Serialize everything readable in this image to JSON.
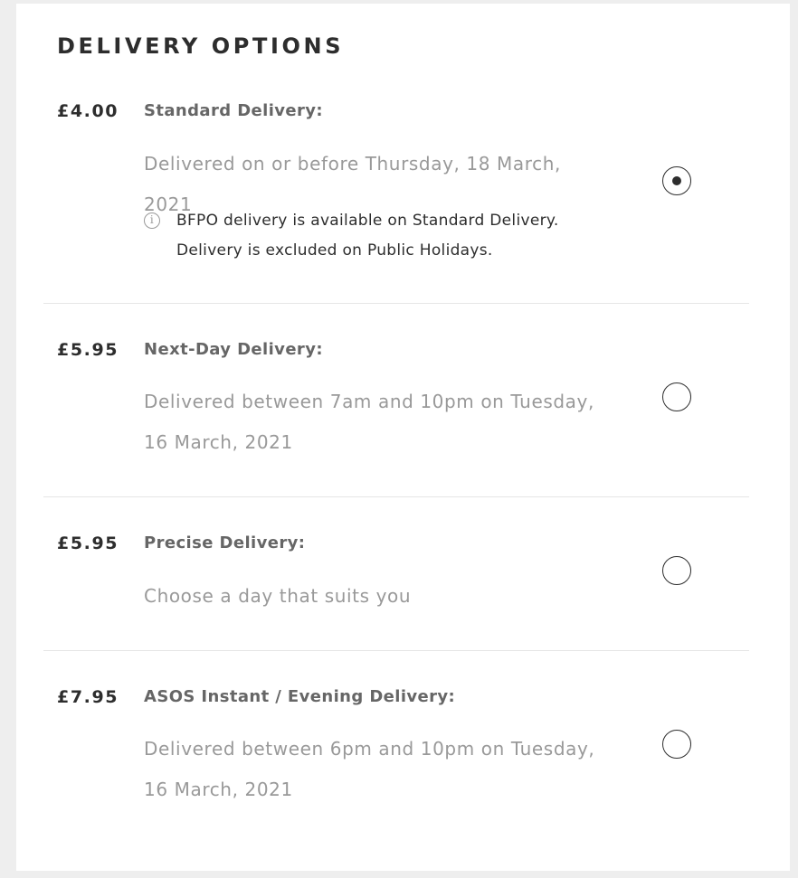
{
  "header": {
    "title": "DELIVERY OPTIONS"
  },
  "options": [
    {
      "price": "£4.00",
      "name": "Standard Delivery:",
      "description": "Delivered on or before Thursday, 18 March, 2021",
      "info_line1": "BFPO delivery is available on Standard Delivery.",
      "info_line2": "Delivery is excluded on Public Holidays.",
      "selected": true
    },
    {
      "price": "£5.95",
      "name": "Next-Day Delivery:",
      "description": "Delivered between 7am and 10pm on Tuesday, 16 March, 2021",
      "selected": false
    },
    {
      "price": "£5.95",
      "name": "Precise Delivery:",
      "description": "Choose a day that suits you",
      "selected": false
    },
    {
      "price": "£7.95",
      "name": "ASOS Instant / Evening Delivery:",
      "description": "Delivered between 6pm and 10pm on Tuesday, 16 March, 2021",
      "selected": false
    }
  ],
  "icons": {
    "info": "info-icon",
    "radio_selected": "radio-selected",
    "radio_unselected": "radio-unselected"
  }
}
